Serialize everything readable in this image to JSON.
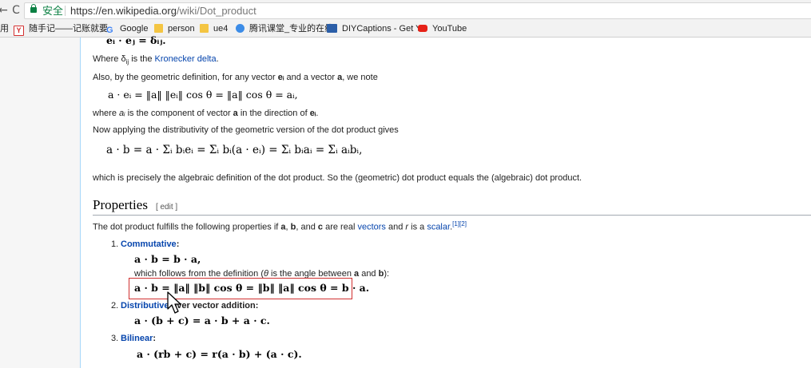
{
  "browser": {
    "secure_label": "安全",
    "url_host": "https://en.wikipedia.org",
    "url_path": "/wiki/Dot_product",
    "back_glyph": "←",
    "forward_glyph": "→",
    "reload_glyph": "C"
  },
  "bookmarks": [
    {
      "label": "用",
      "icon": "bookmark-fragment",
      "color": "#666666"
    },
    {
      "label": "随手记——记账就要",
      "icon": "yandex-icon",
      "color": "#d32f2f"
    },
    {
      "label": "Google",
      "icon": "google-icon",
      "color": "#4285f4"
    },
    {
      "label": "person",
      "icon": "folder-icon",
      "color": "#f4c542"
    },
    {
      "label": "ue4",
      "icon": "folder-icon",
      "color": "#f4c542"
    },
    {
      "label": "腾讯课堂_专业的在线",
      "icon": "tencent-icon",
      "color": "#3c8ce7"
    },
    {
      "label": "DIYCaptions - Get Y",
      "icon": "diycaptions-icon",
      "color": "#2b5ea8"
    },
    {
      "label": "YouTube",
      "icon": "youtube-icon",
      "color": "#e62117"
    }
  ],
  "article": {
    "eq_top": "eᵢ · eⱼ = δᵢⱼ.",
    "where_delta_prefix": "Where δ",
    "where_delta_sub": "ij",
    "where_delta_mid": " is the ",
    "kronecker_link": "Kronecker delta",
    "where_delta_end": ".",
    "also_text": "Also, by the geometric definition, for any vector ",
    "also_ei": "eᵢ",
    "also_mid": " and a vector ",
    "also_a": "a",
    "also_end": ", we note",
    "eq_proj": "a · eᵢ = ‖a‖ ‖eᵢ‖ cos θ = ‖a‖ cos θ = aᵢ,",
    "where_ai_prefix": "where ",
    "where_ai_var": "aᵢ",
    "where_ai_mid": " is the component of vector ",
    "where_ai_a": "a",
    "where_ai_mid2": " in the direction of ",
    "where_ai_ei": "eᵢ",
    "where_ai_end": ".",
    "distrib_text": "Now applying the distributivity of the geometric version of the dot product gives",
    "eq_sum": "a · b = a · Σᵢ bᵢeᵢ = Σᵢ bᵢ(a · eᵢ) = Σᵢ bᵢaᵢ = Σᵢ aᵢbᵢ,",
    "algebraic_text": "which is precisely the algebraic definition of the dot product. So the (geometric) dot product equals the (algebraic) dot product.",
    "properties_heading": "Properties",
    "edit_label": "[ edit ]",
    "props_intro_1": "The dot product fulfills the following properties if ",
    "props_a": "a",
    "props_sep1": ", ",
    "props_b": "b",
    "props_sep2": ", and ",
    "props_c": "c",
    "props_mid": " are real ",
    "vectors_link": "vectors",
    "props_and": " and ",
    "props_r": "r",
    "props_is": " is a ",
    "scalar_link": "scalar",
    "props_end": ".",
    "cite": "[1][2]",
    "items": [
      {
        "num": "1.",
        "label": "Commutative",
        "suffix": ":"
      },
      {
        "num": "2.",
        "label": "Distributive",
        "suffix": " over vector addition:"
      },
      {
        "num": "3.",
        "label": "Bilinear",
        "suffix": ":"
      }
    ],
    "eq_comm": "a · b = b · a,",
    "comm_follow_prefix": "which follows from the definition (",
    "comm_follow_theta": "θ",
    "comm_follow_mid": " is the angle between ",
    "comm_follow_a": "a",
    "comm_follow_and": " and ",
    "comm_follow_b": "b",
    "comm_follow_end": "):",
    "eq_comm_proof": "a · b = ‖a‖ ‖b‖ cos θ = ‖b‖ ‖a‖ cos θ = b · a.",
    "eq_distrib": "a · (b + c) = a · b + a · c.",
    "eq_bilinear": "a · (rb + c) = r(a · b) + (a · c)."
  }
}
